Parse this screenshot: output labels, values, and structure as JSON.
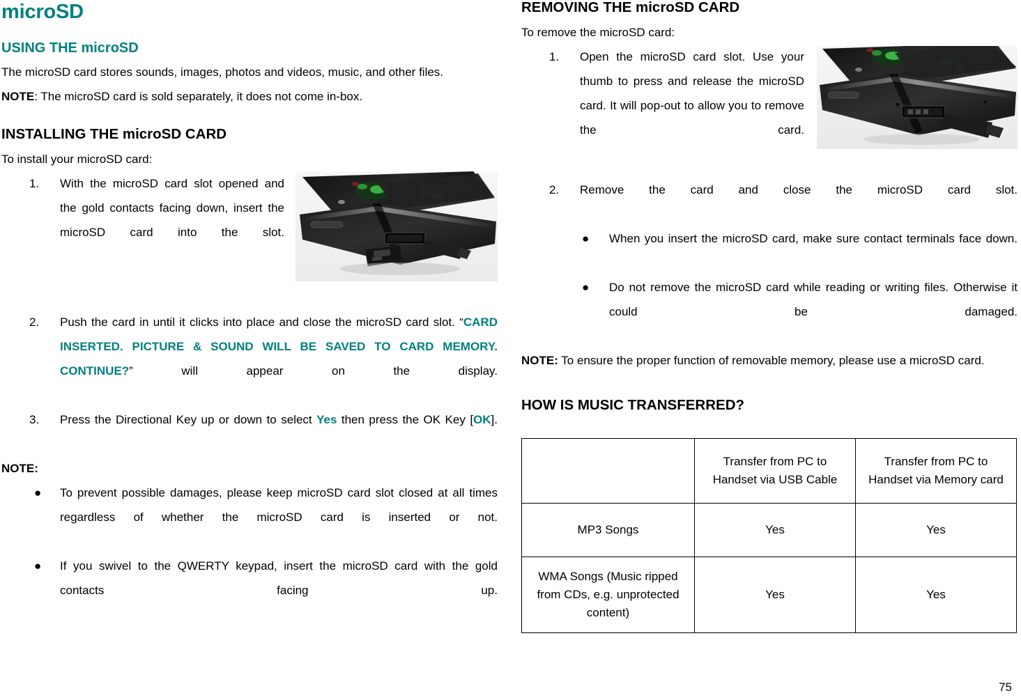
{
  "document": {
    "page_number": "75",
    "accent_color": "#008080"
  },
  "left_column": {
    "title": "microSD",
    "section_using": {
      "heading": "USING THE microSD",
      "paragraph": "The microSD card stores sounds, images, photos and videos, music, and other files.",
      "note_label": "NOTE",
      "note_text": ": The microSD card is sold separately, it does not come in-box."
    },
    "section_installing": {
      "heading": "INSTALLING THE microSD CARD",
      "intro": "To install your microSD card:",
      "steps": [
        {
          "marker": "1.",
          "text": "With the microSD card slot opened and the gold contacts facing down, insert the microSD card into the slot."
        },
        {
          "marker": "2.",
          "pre_text": "Push the card in until it clicks into place and close the microSD card slot. “",
          "highlight": "CARD INSERTED. PICTURE & SOUND WILL BE SAVED TO CARD MEMORY. CONTINUE?",
          "post_text": "” will appear on the display."
        },
        {
          "marker": "3.",
          "pre_text": "Press the Directional Key up or down to select ",
          "highlight1": "Yes",
          "mid_text": " then press the OK Key [",
          "highlight2": "OK",
          "post_text": "]."
        }
      ],
      "note_label": "NOTE:",
      "note_bullets": [
        "To prevent possible damages, please keep microSD card slot closed at all times regardless of whether the microSD card is inserted or not.",
        "If you swivel to the QWERTY keypad, insert the microSD card with the gold contacts facing up."
      ],
      "figure_caption": "phone-with-microsd-card-photo"
    }
  },
  "right_column": {
    "section_removing": {
      "heading": "REMOVING THE microSD CARD",
      "intro": "To remove the microSD card:",
      "steps": [
        {
          "marker": "1.",
          "text": "Open the microSD card slot. Use your thumb to press and release the microSD card. It will pop-out to allow you to remove the card."
        },
        {
          "marker": "2.",
          "text": "Remove the card and close the microSD card slot."
        }
      ],
      "bullets": [
        "When you insert the microSD card, make sure contact terminals face down.",
        "Do not remove the microSD card while reading or writing files. Otherwise it could be damaged."
      ],
      "note_label": "NOTE:",
      "note_text": " To ensure the proper function of removable memory, please use a microSD card.",
      "figure_caption": "phone-card-slot-photo"
    },
    "section_music": {
      "heading": "HOW IS MUSIC TRANSFERRED?",
      "table": {
        "headers": [
          "",
          "Transfer from PC to Handset via USB Cable",
          "Transfer from PC to Handset via Memory card"
        ],
        "rows": [
          [
            "MP3 Songs",
            "Yes",
            "Yes"
          ],
          [
            "WMA Songs (Music ripped from CDs, e.g. unprotected content)",
            "Yes",
            "Yes"
          ]
        ]
      }
    }
  }
}
